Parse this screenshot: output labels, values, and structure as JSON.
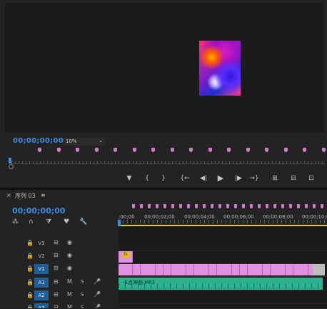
{
  "monitor": {
    "timecode": "00;00;00;00",
    "zoom": "10%",
    "zoom_caret": "⌄"
  },
  "controls": [
    "▼",
    "{",
    "}",
    "{←",
    "◀|",
    "▶",
    "|▶",
    "→}",
    "⊞",
    "⊟",
    "⊡"
  ],
  "timeline": {
    "close": "×",
    "sequence_name": "序列 03",
    "menu": "≡",
    "timecode": "00;00;00;00",
    "tools": [
      "⁂",
      "∩",
      "⧩",
      "♥",
      "🔧"
    ],
    "ruler_labels": [
      ";00;00",
      "00;00;02;00",
      "00;00;04;00",
      "00;00;06;00",
      "00;00;08;00",
      "00;00;10;0"
    ],
    "tracks": [
      {
        "lock": "🔒",
        "name": "V3",
        "i1": "⊟",
        "i2": "◉"
      },
      {
        "lock": "🔒",
        "name": "V2",
        "i1": "⊟",
        "i2": "◉"
      },
      {
        "lock": "🔒",
        "name": "V1",
        "i1": "⊟",
        "i2": "◉",
        "selected": true
      },
      {
        "lock": "🔒",
        "name": "A1",
        "i1": "M",
        "i2": "S",
        "i3": "🎤",
        "selected": true
      },
      {
        "lock": "🔒",
        "name": "A2",
        "i1": "M",
        "i2": "S",
        "i3": "🎤",
        "selected": true
      },
      {
        "lock": "🔒",
        "name": "A3",
        "i1": "M",
        "i2": "S",
        "i3": "🎤",
        "selected": true
      }
    ],
    "fx_badge": "fx",
    "audio_clip_label": "卡点神曲.MP3"
  },
  "colors": {
    "timecode": "#3c8fe0",
    "clip_video": "#e28ee1",
    "clip_audio": "#2db08f",
    "work_area": "#d8d200",
    "marker": "#d37ad0"
  }
}
